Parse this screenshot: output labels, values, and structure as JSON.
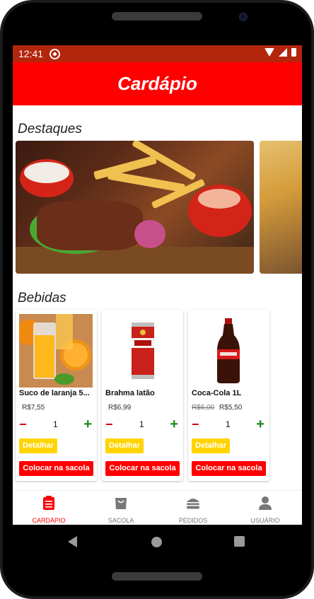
{
  "status_bar": {
    "time": "12:41"
  },
  "header": {
    "title": "Cardápio"
  },
  "sections": {
    "featured": "Destaques",
    "drinks": "Bebidas"
  },
  "products": [
    {
      "name": "Suco de laranja 5...",
      "old_price": "",
      "price": "R$7,55",
      "quantity": "1",
      "detail_label": "Detalhar",
      "bag_label": "Colocar na sacola"
    },
    {
      "name": "Brahma latão",
      "old_price": "",
      "price": "R$6,99",
      "quantity": "1",
      "detail_label": "Detalhar",
      "bag_label": "Colocar na sacola"
    },
    {
      "name": "Coca-Cola 1L",
      "old_price": "R$6,00",
      "price": "R$5,50",
      "quantity": "1",
      "detail_label": "Detalhar",
      "bag_label": "Colocar na sacola"
    }
  ],
  "quantity_controls": {
    "minus": "−",
    "plus": "+"
  },
  "nav": [
    {
      "label": "CARDÁPIO",
      "icon": "clipboard-icon",
      "active": true
    },
    {
      "label": "SACOLA",
      "icon": "bag-icon",
      "active": false
    },
    {
      "label": "PEDIDOS",
      "icon": "burger-icon",
      "active": false
    },
    {
      "label": "USUÁRIO",
      "icon": "user-icon",
      "active": false
    }
  ],
  "colors": {
    "primary": "#ff0000",
    "status_bar": "#b3260c",
    "detail_button": "#ffd400",
    "minus": "#dd0000",
    "plus": "#1a8a1a"
  }
}
